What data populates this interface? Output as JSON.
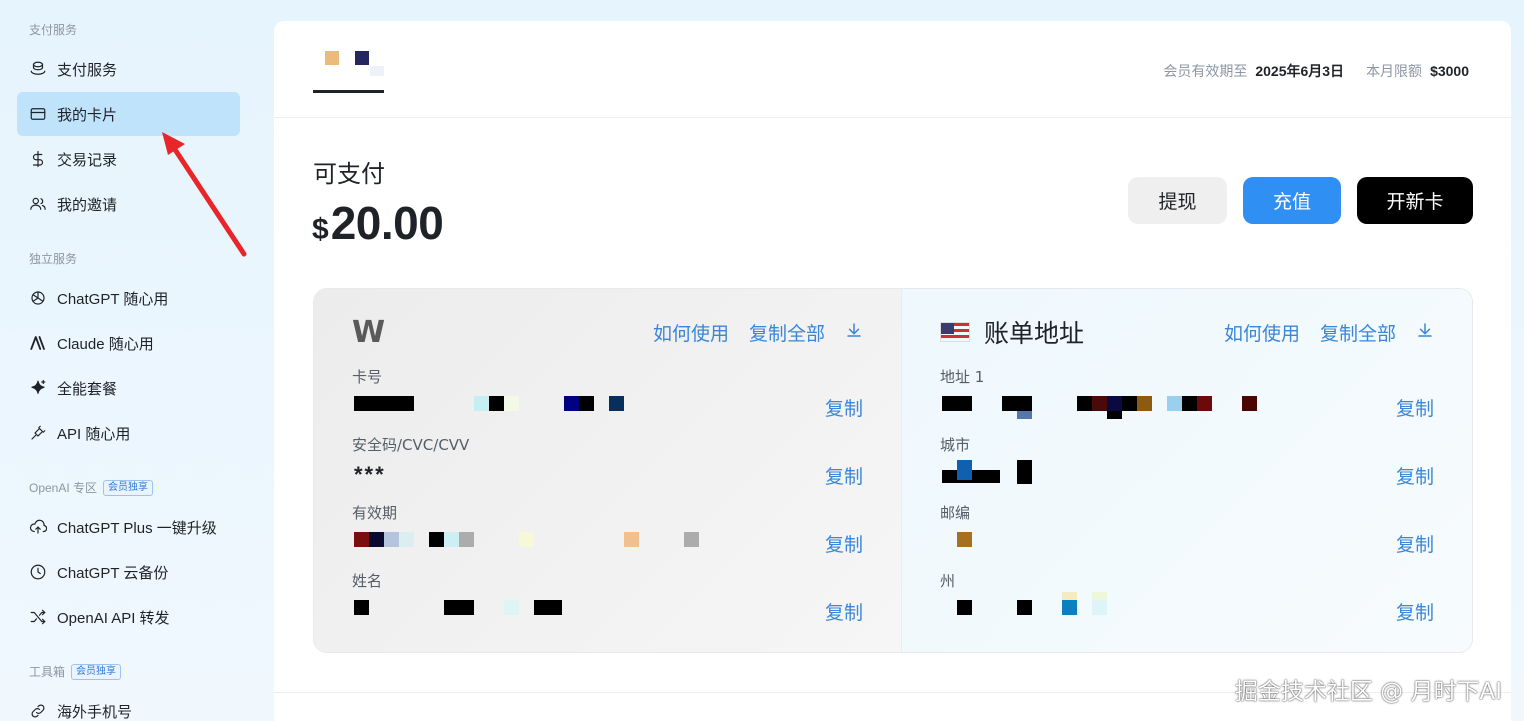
{
  "sidebar": {
    "sections": [
      {
        "title": "支付服务",
        "badge": ""
      },
      {
        "title": "独立服务",
        "badge": ""
      },
      {
        "title": "OpenAI 专区",
        "badge": "会员独享"
      },
      {
        "title": "工具箱",
        "badge": "会员独享"
      }
    ],
    "items": [
      {
        "label": "支付服务",
        "icon": "coins-icon"
      },
      {
        "label": "我的卡片",
        "icon": "card-icon",
        "active": true
      },
      {
        "label": "交易记录",
        "icon": "dollar-icon"
      },
      {
        "label": "我的邀请",
        "icon": "users-icon"
      },
      {
        "label": "ChatGPT 随心用",
        "icon": "openai-icon"
      },
      {
        "label": "Claude 随心用",
        "icon": "anthropic-icon"
      },
      {
        "label": "全能套餐",
        "icon": "sparkle-icon"
      },
      {
        "label": "API 随心用",
        "icon": "plug-icon"
      },
      {
        "label": "ChatGPT Plus 一键升级",
        "icon": "upload-cloud-icon"
      },
      {
        "label": "ChatGPT 云备份",
        "icon": "clock-icon"
      },
      {
        "label": "OpenAI API 转发",
        "icon": "shuffle-icon"
      },
      {
        "label": "海外手机号",
        "icon": "link-icon"
      }
    ]
  },
  "header": {
    "member_label": "会员有效期至",
    "member_value": "2025年6月3日",
    "limit_label": "本月限额",
    "limit_value": "$3000"
  },
  "balance": {
    "label": "可支付",
    "currency": "$",
    "amount": "20.00"
  },
  "actions": {
    "withdraw": "提现",
    "topup": "充值",
    "new_card": "开新卡"
  },
  "card": {
    "brand": "W",
    "how_to": "如何使用",
    "copy_all": "复制全部",
    "fields": [
      {
        "label": "卡号",
        "value": ""
      },
      {
        "label": "安全码/CVC/CVV",
        "value": "***"
      },
      {
        "label": "有效期",
        "value": ""
      },
      {
        "label": "姓名",
        "value": ""
      }
    ],
    "copy": "复制"
  },
  "billing": {
    "title": "账单地址",
    "how_to": "如何使用",
    "copy_all": "复制全部",
    "fields": [
      {
        "label": "地址 1"
      },
      {
        "label": "城市"
      },
      {
        "label": "邮编"
      },
      {
        "label": "州"
      }
    ],
    "copy": "复制"
  },
  "watermark": "掘金技术社区 @ 月时下AI",
  "colors": {
    "accent": "#2f8ff2",
    "link": "#3a86d8",
    "active_nav": "#bfe3fb",
    "annotation_arrow": "#e8262a"
  }
}
